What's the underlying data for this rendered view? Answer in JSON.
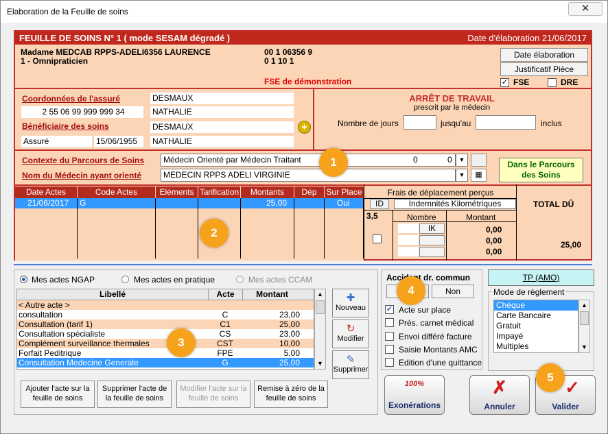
{
  "window": {
    "title": "Elaboration de la Feuille de soins",
    "close": "✕"
  },
  "header": {
    "title": "FEUILLE DE SOINS  N° 1 ( mode SESAM dégradé )",
    "date": "Date d'élaboration 21/06/2017",
    "doctor_name": "Madame MEDCAB RPPS-ADELI6356 LAURENCE",
    "doctor_specialty": "1 - Omnipraticien",
    "code1": "00 1 06356 9",
    "code2": "0 1 10 1",
    "fse_demo": "FSE de démonstration",
    "btn_date": "Date élaboration",
    "btn_justif": "Justificatif Pièce",
    "fse_label": "FSE",
    "dre_label": "DRE",
    "fse_checked": "✓",
    "dre_checked": ""
  },
  "insured": {
    "coord_label": "Coordonnées de l'assuré",
    "nir": "2 55 06 99 999 999 34",
    "nom": "DESMAUX",
    "prenom": "NATHALIE",
    "benef_label": "Bénéficiaire des soins",
    "benef_nom": "DESMAUX",
    "benef_type": "Assuré",
    "benef_date": "15/06/1955",
    "benef_prenom": "NATHALIE"
  },
  "arret": {
    "title": "ARRÊT DE TRAVAIL",
    "subtitle": "prescrit par le médecin",
    "jours": "Nombre de jours",
    "jusquau": "jusqu'au",
    "inclus": "inclus"
  },
  "parcours": {
    "ctx_label": "Contexte du Parcours de Soins",
    "ctx_value": "Médecin Orienté par Médecin Traitant",
    "ctx_n1": "0",
    "ctx_n2": "0",
    "nom_label": "Nom du Médecin ayant orienté",
    "nom_value": "MEDECIN RPPS ADELI   VIRGINIE",
    "status": "Dans le Parcours des Soins"
  },
  "acts_table": {
    "headers": [
      "Date Actes",
      "Code Actes",
      "Eléments",
      "Tarification",
      "Montants",
      "Dép",
      "Sur Place"
    ],
    "row": {
      "date": "21/06/2017",
      "code": "G",
      "montant": "25,00",
      "surplace": "Oui"
    }
  },
  "frais": {
    "title": "Frais de déplacement perçus",
    "id": "ID",
    "ik_label": "Indemnités Kilométriques",
    "val": "3,5",
    "nombre": "Nombre",
    "montant": "Montant",
    "ik": "IK",
    "m1": "0,00",
    "m2": "0,00",
    "m3": "0,00",
    "total_label": "TOTAL DÛ",
    "total": "25,00"
  },
  "ngap": {
    "radio1": "Mes actes NGAP",
    "radio2": "Mes actes en pratique",
    "radio3": "Mes actes CCAM",
    "col1": "Libellé",
    "col2": "Acte",
    "col3": "Montant",
    "rows": [
      {
        "lib": "< Autre acte >",
        "acte": "",
        "mt": ""
      },
      {
        "lib": "consultation",
        "acte": "C",
        "mt": "23,00"
      },
      {
        "lib": "Consultation (tarif 1)",
        "acte": "C1",
        "mt": "25,00"
      },
      {
        "lib": "Consultation spécialiste",
        "acte": "CS",
        "mt": "23,00"
      },
      {
        "lib": "Complément surveillance thermales",
        "acte": "CST",
        "mt": "10,00"
      },
      {
        "lib": "Forfait Peditrique",
        "acte": "FPE",
        "mt": "5,00"
      },
      {
        "lib": "Consultation Medecine Generale",
        "acte": "G",
        "mt": "25,00"
      }
    ],
    "btn_nouveau": "Nouveau",
    "btn_modifier": "Modifier",
    "btn_supprimer": "Supprimer",
    "act_add": "Ajouter l'acte sur la feuille de soins",
    "act_del": "Supprimer l'acte de la feuille de soins",
    "act_mod": "Modifier l'acte sur la feuille de soins",
    "act_reset": "Remise à zéro de la feuille de soins"
  },
  "accident": {
    "title": "Accident dr. commun",
    "non": "Non",
    "chk1": "Acte sur place",
    "chk2": "Prés. carnet médical",
    "chk3": "Envoi différé facture",
    "chk4": "Saisie Montants AMC",
    "chk5": "Edition d'une quittance"
  },
  "reglement": {
    "tp": "TP (AMO)",
    "title": "Mode de règlement",
    "items": [
      "Chèque",
      "Carte Bancaire",
      "Gratuit",
      "Impayé",
      "Multiples"
    ]
  },
  "footer": {
    "exo": "Exonérations",
    "annuler": "Annuler",
    "valider": "Valider",
    "stamp": "100%"
  },
  "badges": [
    "1",
    "2",
    "3",
    "4",
    "5"
  ],
  "colors": {
    "accent_red": "#c2302b",
    "panel": "#fbd5b5",
    "select_blue": "#3399ff",
    "green_text": "#006400",
    "badge": "#f6a21a"
  }
}
